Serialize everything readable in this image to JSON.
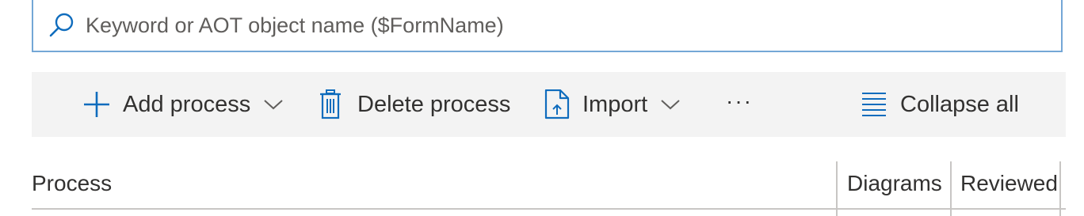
{
  "search": {
    "placeholder": "Keyword or AOT object name ($FormName)",
    "value": ""
  },
  "toolbar": {
    "add_process_label": "Add process",
    "delete_process_label": "Delete process",
    "import_label": "Import",
    "more_label": "···",
    "collapse_all_label": "Collapse all"
  },
  "table": {
    "columns": [
      "Process",
      "Diagrams",
      "Reviewed"
    ]
  },
  "colors": {
    "accent": "#0f6cbd",
    "toolbar_bg": "#f3f3f3",
    "search_border": "#74a7d6",
    "divider": "#c8c6c4"
  }
}
